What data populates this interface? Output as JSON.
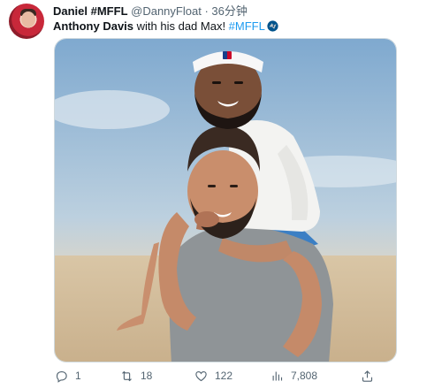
{
  "user": {
    "display_name": "Daniel #MFFL",
    "handle": "@DannyFloat",
    "separator": "·",
    "time": "36分钟"
  },
  "tweet": {
    "bold_text": "Anthony Davis",
    "text": " with his dad Max! ",
    "hashtag": "#MFFL",
    "emoji": "mavericks-logo-icon"
  },
  "media": {
    "description_icon": "photo"
  },
  "actions": {
    "reply_count": "1",
    "retweet_count": "18",
    "like_count": "122",
    "views_count": "7,808",
    "reply_icon": "reply-icon",
    "retweet_icon": "retweet-icon",
    "like_icon": "heart-icon",
    "views_icon": "views-icon",
    "share_icon": "share-icon"
  },
  "colors": {
    "text": "#0f1419",
    "secondary": "#536471",
    "link": "#1d9bf0",
    "border": "#cfd9de"
  }
}
